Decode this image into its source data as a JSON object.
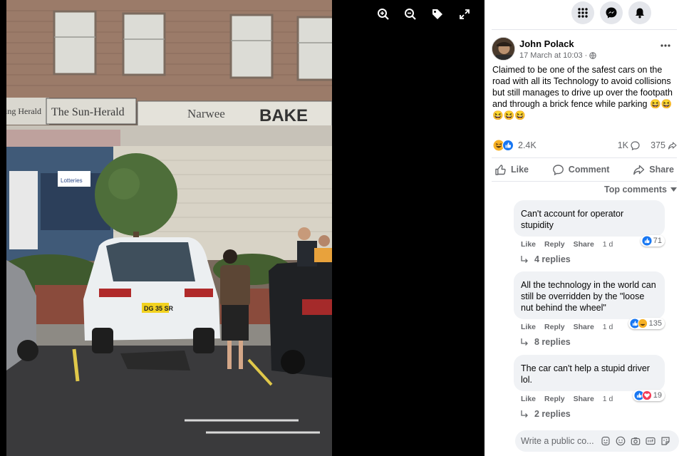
{
  "photo": {
    "sign_left": "ing Herald",
    "sign_sun_herald": "The Sun-Herald",
    "sign_narwee": "Narwee",
    "sign_bake": "BAKE",
    "lotteries_sign": "Lotteries",
    "plate": "DG 35 SR"
  },
  "viewer_tools": [
    "zoom-in-icon",
    "zoom-out-icon",
    "tag-icon",
    "fullscreen-icon"
  ],
  "topbar": [
    "menu-grid-icon",
    "messenger-icon",
    "bell-icon"
  ],
  "post": {
    "author": "John Polack",
    "timestamp": "17 March at 10:03",
    "audience_icon": "globe-icon",
    "text": "Claimed to be one of the safest cars on the road with all its Technology to avoid collisions but still manages to drive up over the footpath and through a brick fence while parking 😆😆😆😆😆",
    "reaction_count": "2.4K",
    "comment_count": "1K",
    "share_count": "375"
  },
  "actions": {
    "like": "Like",
    "comment": "Comment",
    "share": "Share"
  },
  "sort_label": "Top comments",
  "comments": [
    {
      "text": "Can't account for operator stupidity",
      "like": "Like",
      "reply": "Reply",
      "share": "Share",
      "time": "1 d",
      "reactions": "71",
      "replies": "4 replies"
    },
    {
      "text": "All the technology in the world can still be overridden by the \"loose nut behind the wheel\"",
      "like": "Like",
      "reply": "Reply",
      "share": "Share",
      "time": "1 d",
      "reactions": "135",
      "replies": "8 replies"
    },
    {
      "text": "The car can't help a stupid driver lol.",
      "like": "Like",
      "reply": "Reply",
      "share": "Share",
      "time": "1 d",
      "reactions": "19",
      "replies": "2 replies"
    }
  ],
  "write_comment": {
    "placeholder": "Write a public co..."
  },
  "colors": {
    "like_blue": "#1877f2",
    "haha_yellow": "#f7b125",
    "love_red": "#f33e58",
    "secondary_text": "#65676b",
    "bubble_bg": "#f0f2f5"
  }
}
